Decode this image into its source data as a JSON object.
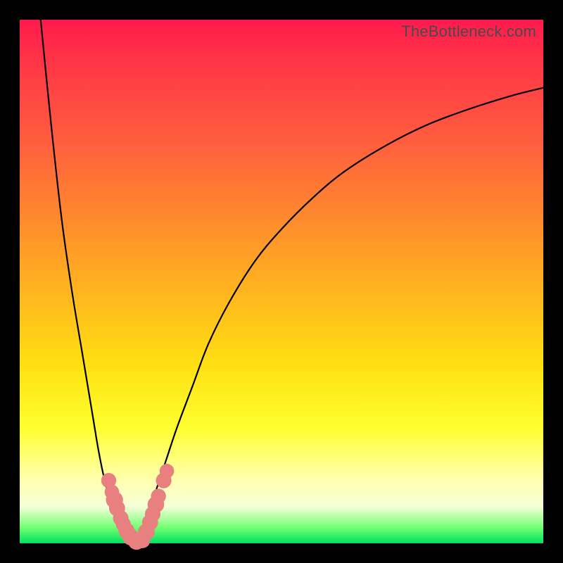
{
  "watermark": "TheBottleneck.com",
  "colors": {
    "frame": "#000000",
    "gradient_top": "#ff1a4d",
    "gradient_bottom": "#00e060",
    "curve": "#000000",
    "dot": "#e98080"
  },
  "chart_data": {
    "type": "line",
    "title": "",
    "xlabel": "",
    "ylabel": "",
    "xlim": [
      0,
      100
    ],
    "ylim": [
      0,
      100
    ],
    "series": [
      {
        "name": "left-branch",
        "x": [
          4,
          6,
          8,
          10,
          12,
          14,
          15,
          16,
          17,
          18,
          19,
          20,
          21,
          22
        ],
        "y": [
          100,
          80,
          62,
          48,
          36,
          24,
          18,
          13,
          9,
          6,
          3.5,
          1.8,
          0.6,
          0
        ]
      },
      {
        "name": "right-branch",
        "x": [
          22,
          24,
          26,
          28,
          30,
          33,
          36,
          40,
          45,
          50,
          56,
          62,
          70,
          78,
          86,
          94,
          100
        ],
        "y": [
          0,
          4,
          10,
          16,
          22,
          30,
          38,
          46,
          54,
          60,
          66,
          71,
          76,
          80,
          83,
          85.5,
          87
        ]
      }
    ],
    "markers": [
      {
        "x": 17.0,
        "y": 12.0,
        "r": 1.8
      },
      {
        "x": 17.6,
        "y": 9.8,
        "r": 1.7
      },
      {
        "x": 18.1,
        "y": 8.3,
        "r": 2.2
      },
      {
        "x": 18.6,
        "y": 6.7,
        "r": 2.0
      },
      {
        "x": 19.3,
        "y": 4.8,
        "r": 1.9
      },
      {
        "x": 19.8,
        "y": 3.6,
        "r": 1.8
      },
      {
        "x": 20.4,
        "y": 2.4,
        "r": 2.0
      },
      {
        "x": 21.2,
        "y": 1.2,
        "r": 2.1
      },
      {
        "x": 22.3,
        "y": 0.4,
        "r": 2.2
      },
      {
        "x": 23.4,
        "y": 0.6,
        "r": 2.0
      },
      {
        "x": 24.2,
        "y": 2.2,
        "r": 2.1
      },
      {
        "x": 24.9,
        "y": 4.0,
        "r": 2.0
      },
      {
        "x": 25.4,
        "y": 5.6,
        "r": 1.9
      },
      {
        "x": 26.0,
        "y": 7.4,
        "r": 2.1
      },
      {
        "x": 26.5,
        "y": 9.0,
        "r": 1.8
      },
      {
        "x": 27.5,
        "y": 12.0,
        "r": 1.9
      },
      {
        "x": 28.1,
        "y": 13.8,
        "r": 1.7
      }
    ]
  }
}
